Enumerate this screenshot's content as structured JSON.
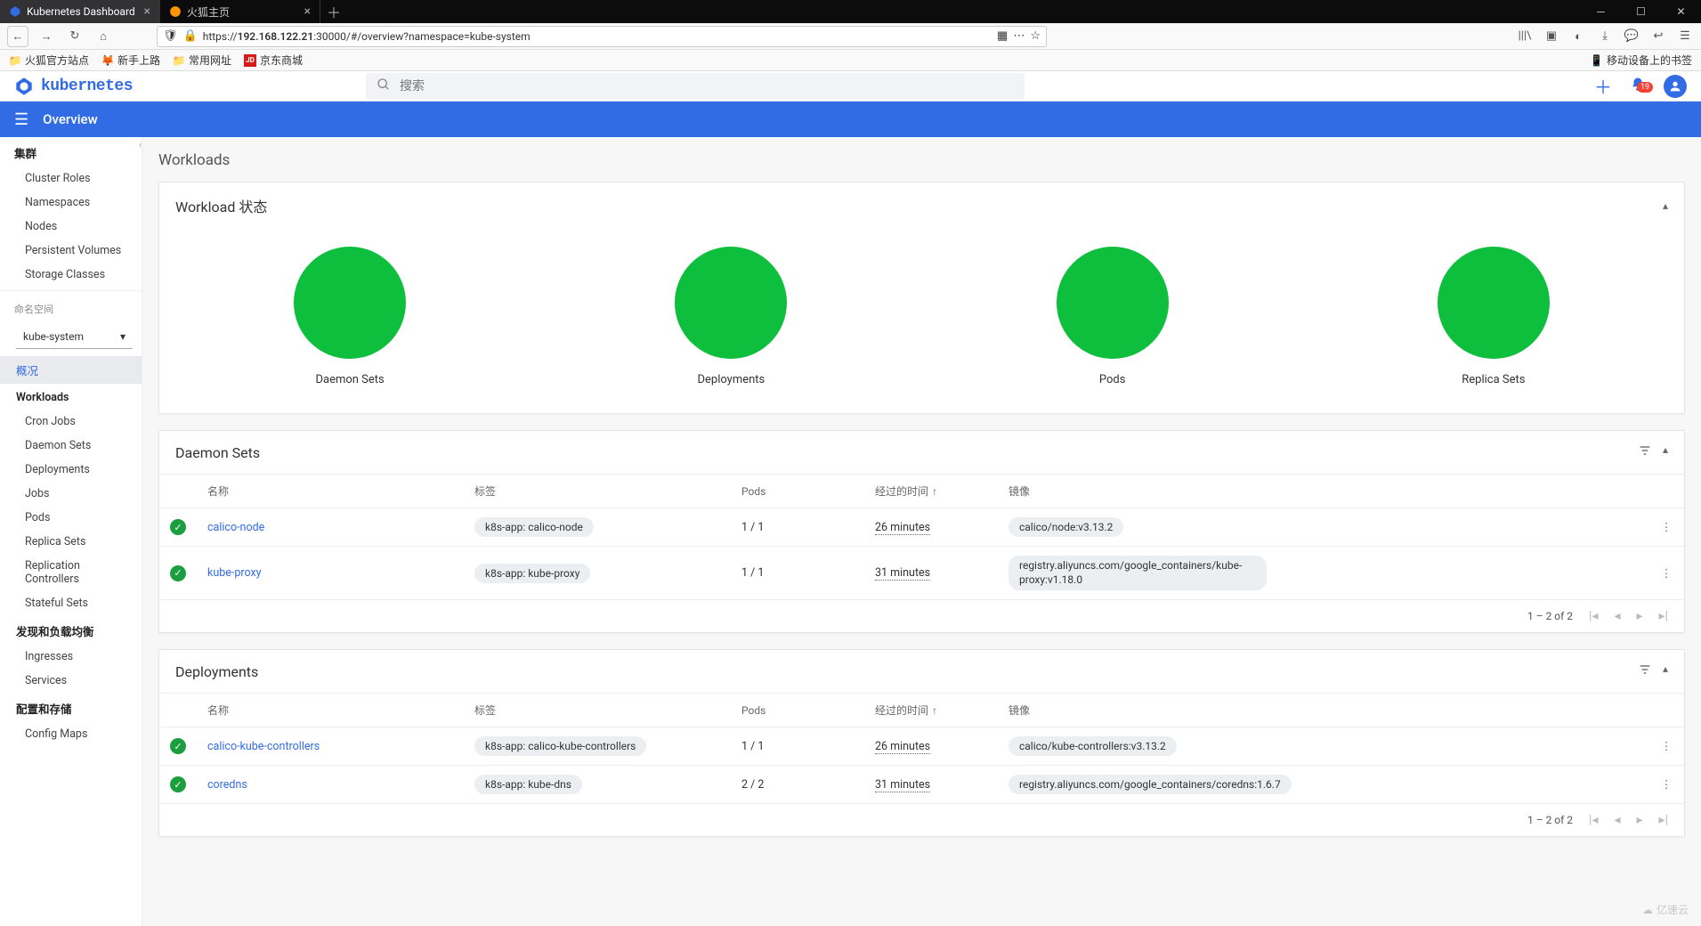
{
  "browser": {
    "tabs": [
      {
        "favicon": "k8s",
        "title": "Kubernetes Dashboard",
        "active": true
      },
      {
        "favicon": "firefox",
        "title": "火狐主页",
        "active": false
      }
    ],
    "url_prefix": "https://",
    "url_host": "192.168.122.21",
    "url_rest": ":30000/#/overview?namespace=kube-system",
    "bookmarks": [
      "火狐官方站点",
      "新手上路",
      "常用网址",
      "京东商城"
    ],
    "bookmark_jd_badge": "JD",
    "mobile_bookmark": "移动设备上的书签"
  },
  "header": {
    "logo_text": "kubernetes",
    "search_placeholder": "搜索",
    "badge_count": "19"
  },
  "blue_bar": {
    "title": "Overview"
  },
  "sidebar": {
    "cluster_heading": "集群",
    "cluster_items": [
      "Cluster Roles",
      "Namespaces",
      "Nodes",
      "Persistent Volumes",
      "Storage Classes"
    ],
    "ns_heading": "命名空间",
    "ns_value": "kube-system",
    "overview_item": "概况",
    "workloads_heading": "Workloads",
    "workloads_items": [
      "Cron Jobs",
      "Daemon Sets",
      "Deployments",
      "Jobs",
      "Pods",
      "Replica Sets",
      "Replication Controllers",
      "Stateful Sets"
    ],
    "lb_heading": "发现和负载均衡",
    "lb_items": [
      "Ingresses",
      "Services"
    ],
    "storage_heading": "配置和存储",
    "storage_items": [
      "Config Maps"
    ]
  },
  "content": {
    "title": "Workloads",
    "status_card": {
      "title": "Workload 状态",
      "items": [
        "Daemon Sets",
        "Deployments",
        "Pods",
        "Replica Sets"
      ]
    },
    "columns": {
      "name": "名称",
      "labels": "标签",
      "pods": "Pods",
      "elapsed": "经过的时间",
      "image": "镜像"
    },
    "daemonsets": {
      "title": "Daemon Sets",
      "rows": [
        {
          "name": "calico-node",
          "label": "k8s-app: calico-node",
          "pods": "1 / 1",
          "elapsed": "26 minutes",
          "image": "calico/node:v3.13.2"
        },
        {
          "name": "kube-proxy",
          "label": "k8s-app: kube-proxy",
          "pods": "1 / 1",
          "elapsed": "31 minutes",
          "image": "registry.aliyuncs.com/google_containers/kube-proxy:v1.18.0"
        }
      ],
      "pager": "1 – 2 of 2"
    },
    "deployments": {
      "title": "Deployments",
      "rows": [
        {
          "name": "calico-kube-controllers",
          "label": "k8s-app: calico-kube-controllers",
          "pods": "1 / 1",
          "elapsed": "26 minutes",
          "image": "calico/kube-controllers:v3.13.2"
        },
        {
          "name": "coredns",
          "label": "k8s-app: kube-dns",
          "pods": "2 / 2",
          "elapsed": "31 minutes",
          "image": "registry.aliyuncs.com/google_containers/coredns:1.6.7"
        }
      ],
      "pager": "1 – 2 of 2"
    }
  },
  "watermark": "亿速云",
  "chart_data": {
    "type": "pie",
    "note": "four single-slice 100% pies indicating all workloads healthy",
    "series": [
      {
        "name": "Daemon Sets",
        "values": [
          100
        ],
        "color": "#0dbf3c"
      },
      {
        "name": "Deployments",
        "values": [
          100
        ],
        "color": "#0dbf3c"
      },
      {
        "name": "Pods",
        "values": [
          100
        ],
        "color": "#0dbf3c"
      },
      {
        "name": "Replica Sets",
        "values": [
          100
        ],
        "color": "#0dbf3c"
      }
    ]
  }
}
